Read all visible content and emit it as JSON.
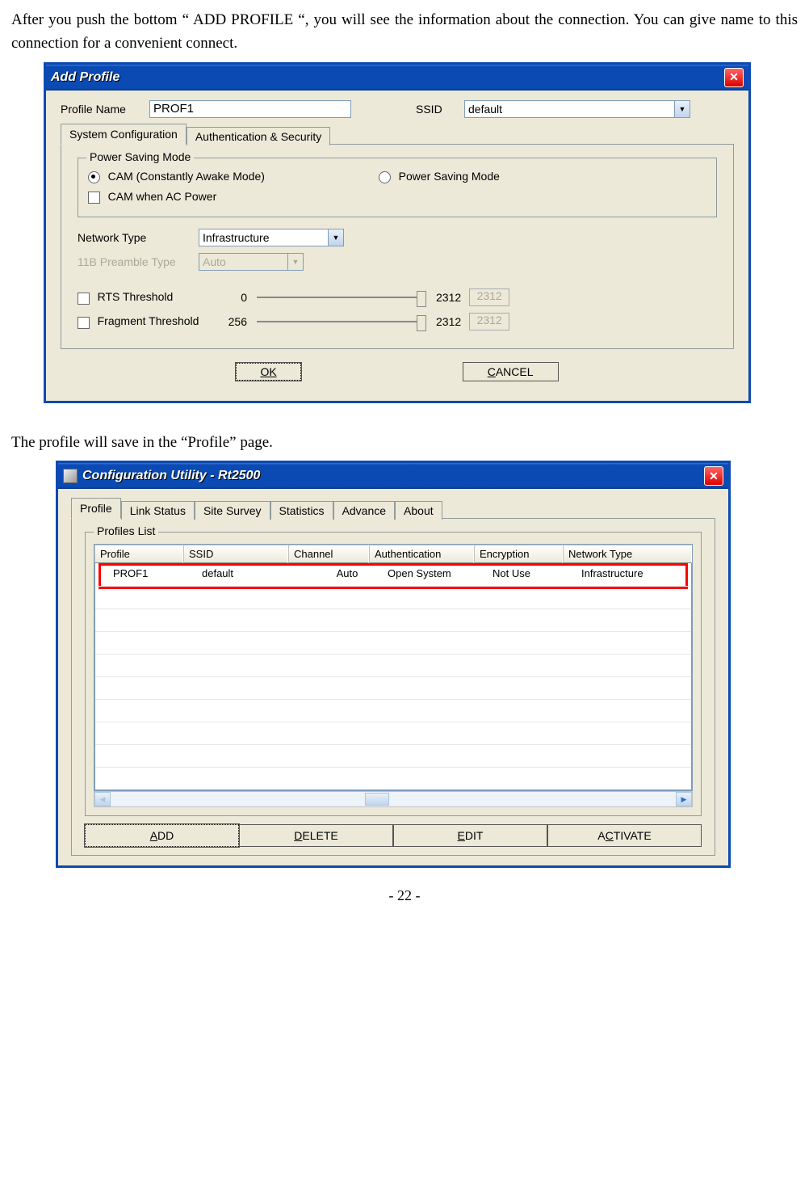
{
  "intro": "After you push the bottom “ ADD PROFILE “, you will see the information about the connection. You can give name to this connection for a convenient connect.",
  "dlg1": {
    "title": "Add Profile",
    "profileNameLabel": "Profile Name",
    "profileNameValue": "PROF1",
    "ssidLabel": "SSID",
    "ssidValue": "default",
    "tabs": [
      "System Configuration",
      "Authentication & Security"
    ],
    "group": "Power Saving Mode",
    "opt1": "CAM (Constantly Awake Mode)",
    "opt2": "Power Saving Mode",
    "chk1": "CAM when AC Power",
    "netTypeLabel": "Network Type",
    "netTypeValue": "Infrastructure",
    "preambleLabel": "11B Preamble Type",
    "preambleValue": "Auto",
    "rtsLabel": "RTS Threshold",
    "rtsMin": "0",
    "rtsMax": "2312",
    "rtsVal": "2312",
    "fragLabel": "Fragment Threshold",
    "fragMin": "256",
    "fragMax": "2312",
    "fragVal": "2312",
    "ok": "OK",
    "cancel": "CANCEL"
  },
  "mid": "The profile will save in the “Profile” page.",
  "dlg2": {
    "title": "Configuration Utility - Rt2500",
    "tabs": [
      "Profile",
      "Link Status",
      "Site Survey",
      "Statistics",
      "Advance",
      "About"
    ],
    "group": "Profiles List",
    "cols": [
      "Profile",
      "SSID",
      "Channel",
      "Authentication",
      "Encryption",
      "Network Type"
    ],
    "row": [
      "PROF1",
      "default",
      "Auto",
      "Open System",
      "Not Use",
      "Infrastructure"
    ],
    "btns": [
      "ADD",
      "DELETE",
      "EDIT",
      "ACTIVATE"
    ]
  },
  "page": "- 22 -"
}
